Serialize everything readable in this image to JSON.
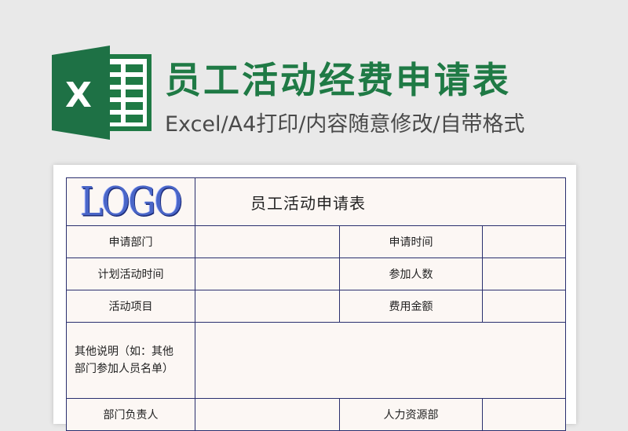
{
  "banner": {
    "title": "员工活动经费申请表",
    "subtitle": "Excel/A4打印/内容随意修改/自带格式",
    "icon": "excel-icon",
    "icon_letter": "X",
    "colors": {
      "brand_green": "#1f7a45",
      "excel_dark": "#185c37",
      "excel_mid": "#21a366"
    }
  },
  "form": {
    "logo_text": "LOGO",
    "title": "员工活动申请表",
    "rows": [
      {
        "left_label": "申请部门",
        "right_label": "申请时间"
      },
      {
        "left_label": "计划活动时间",
        "right_label": "参加人数"
      },
      {
        "left_label": "活动项目",
        "right_label": "费用金额"
      }
    ],
    "note_label_line1": "其他说明（如：其他",
    "note_label_line2": "部门参加人员名单）",
    "last_row": {
      "left_label": "部门负责人",
      "right_label": "人力资源部"
    }
  }
}
